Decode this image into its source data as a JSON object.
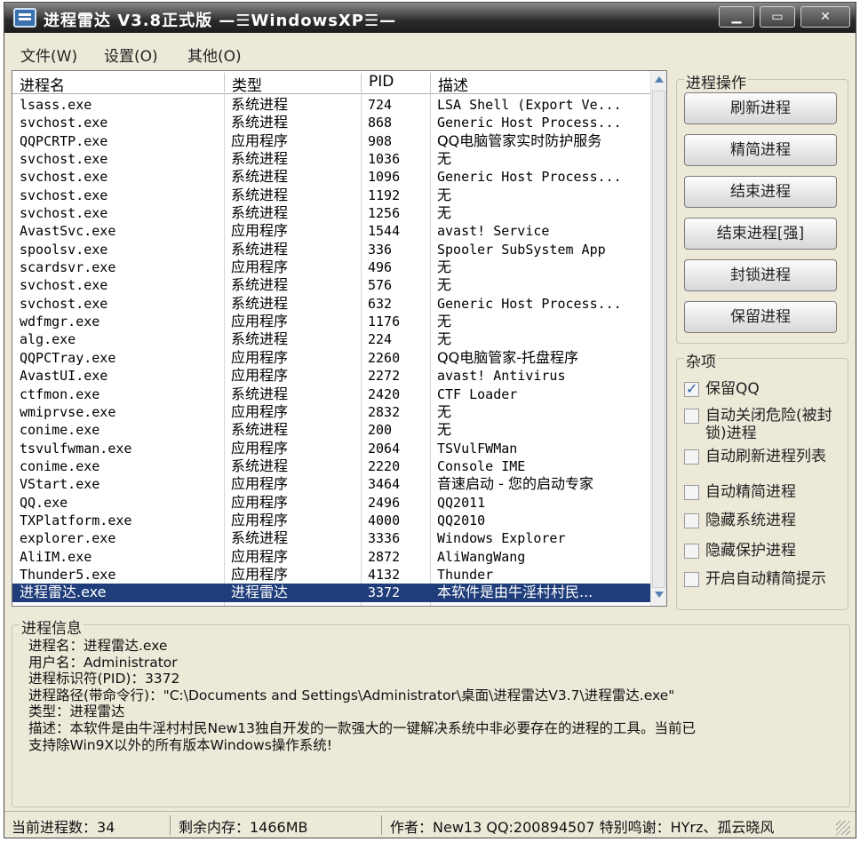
{
  "titlebar": {
    "title": "进程雷达 V3.8正式版  —☰WindowsXP☰—",
    "minimize_label": "▁",
    "maximize_label": "▭",
    "close_label": "✕"
  },
  "menu": {
    "file": "文件(W)",
    "settings": "设置(O)",
    "other": "其他(O)"
  },
  "process_table": {
    "headers": [
      "进程名",
      "类型",
      "PID",
      "描述"
    ],
    "rows": [
      [
        "lsass.exe",
        "系统进程",
        "724",
        "LSA Shell (Export Ve..."
      ],
      [
        "svchost.exe",
        "系统进程",
        "868",
        "Generic Host Process..."
      ],
      [
        "QQPCRTP.exe",
        "应用程序",
        "908",
        "QQ电脑管家实时防护服务"
      ],
      [
        "svchost.exe",
        "系统进程",
        "1036",
        "无"
      ],
      [
        "svchost.exe",
        "系统进程",
        "1096",
        "Generic Host Process..."
      ],
      [
        "svchost.exe",
        "系统进程",
        "1192",
        "无"
      ],
      [
        "svchost.exe",
        "系统进程",
        "1256",
        "无"
      ],
      [
        "AvastSvc.exe",
        "应用程序",
        "1544",
        "avast! Service"
      ],
      [
        "spoolsv.exe",
        "系统进程",
        "336",
        "Spooler SubSystem App"
      ],
      [
        "scardsvr.exe",
        "应用程序",
        "496",
        "无"
      ],
      [
        "svchost.exe",
        "系统进程",
        "576",
        "无"
      ],
      [
        "svchost.exe",
        "系统进程",
        "632",
        "Generic Host Process..."
      ],
      [
        "wdfmgr.exe",
        "应用程序",
        "1176",
        "无"
      ],
      [
        "alg.exe",
        "系统进程",
        "224",
        "无"
      ],
      [
        "QQPCTray.exe",
        "应用程序",
        "2260",
        "QQ电脑管家-托盘程序"
      ],
      [
        "AvastUI.exe",
        "应用程序",
        "2272",
        "avast! Antivirus"
      ],
      [
        "ctfmon.exe",
        "系统进程",
        "2420",
        "CTF Loader"
      ],
      [
        "wmiprvse.exe",
        "应用程序",
        "2832",
        "无"
      ],
      [
        "conime.exe",
        "系统进程",
        "200",
        "无"
      ],
      [
        "tsvulfwman.exe",
        "应用程序",
        "2064",
        "TSVulFWMan"
      ],
      [
        "conime.exe",
        "系统进程",
        "2220",
        "Console IME"
      ],
      [
        "VStart.exe",
        "应用程序",
        "3464",
        "音速启动 - 您的启动专家"
      ],
      [
        "QQ.exe",
        "应用程序",
        "2496",
        "QQ2011"
      ],
      [
        "TXPlatform.exe",
        "应用程序",
        "4000",
        "QQ2010"
      ],
      [
        "explorer.exe",
        "系统进程",
        "3336",
        "Windows Explorer"
      ],
      [
        "AliIM.exe",
        "应用程序",
        "2872",
        "AliWangWang"
      ],
      [
        "Thunder5.exe",
        "应用程序",
        "4132",
        "Thunder"
      ],
      [
        "进程雷达.exe",
        "进程雷达",
        "3372",
        "本软件是由牛淫村村民..."
      ]
    ],
    "selected_index": 27
  },
  "process_ops": {
    "title": "进程操作",
    "buttons": [
      "刷新进程",
      "精简进程",
      "结束进程",
      "结束进程[强]",
      "封锁进程",
      "保留进程"
    ]
  },
  "misc": {
    "title": "杂项",
    "options": [
      {
        "label": "保留QQ",
        "checked": true
      },
      {
        "label": "自动关闭危险(被封锁)进程",
        "checked": false
      },
      {
        "label": "自动刷新进程列表",
        "checked": false
      },
      {
        "label": "自动精简进程",
        "checked": false
      },
      {
        "label": "隐藏系统进程",
        "checked": false
      },
      {
        "label": "隐藏保护进程",
        "checked": false
      },
      {
        "label": "开启自动精简提示",
        "checked": false
      }
    ]
  },
  "process_info": {
    "title": "进程信息",
    "lines": [
      "进程名：进程雷达.exe",
      "用户名：Administrator",
      "进程标识符(PID)：3372",
      "进程路径(带命令行)：\"C:\\Documents and Settings\\Administrator\\桌面\\进程雷达V3.7\\进程雷达.exe\"",
      "类型：进程雷达",
      "描述：本软件是由牛淫村村民New13独自开发的一款强大的一键解决系统中非必要存在的进程的工具。当前已",
      "支持除Win9X以外的所有版本Windows操作系统!"
    ]
  },
  "status": {
    "process_count": "当前进程数：34",
    "free_memory": "剩余内存：1466MB",
    "credits": "作者：New13 QQ:200894507 特别鸣谢：HYrz、孤云晓风"
  }
}
